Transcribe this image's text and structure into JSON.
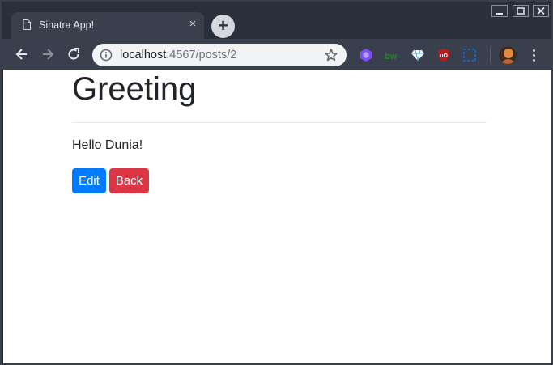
{
  "browser": {
    "tab": {
      "title": "Sinatra App!",
      "close_glyph": "×",
      "icon": "page-icon"
    },
    "new_tab_glyph": "+",
    "window_controls": [
      "minimize-icon",
      "maximize-icon",
      "close-icon"
    ],
    "address": {
      "host": "localhost",
      "path": ":4567/posts/2"
    },
    "extensions": [
      {
        "name": "purple-hex-extension-icon",
        "color": "#7c4dff"
      },
      {
        "name": "bw-extension-icon",
        "color": "#2e7d32"
      },
      {
        "name": "diamond-extension-icon",
        "color": "#ffffff"
      },
      {
        "name": "ublock-extension-icon",
        "color": "#b71c1c"
      },
      {
        "name": "blue-square-extension-icon",
        "color": "#1565c0"
      }
    ]
  },
  "page": {
    "heading": "Greeting",
    "body": "Hello Dunia!",
    "buttons": {
      "edit": "Edit",
      "back": "Back"
    }
  },
  "colors": {
    "primary": "#007bff",
    "danger": "#dc3545"
  }
}
